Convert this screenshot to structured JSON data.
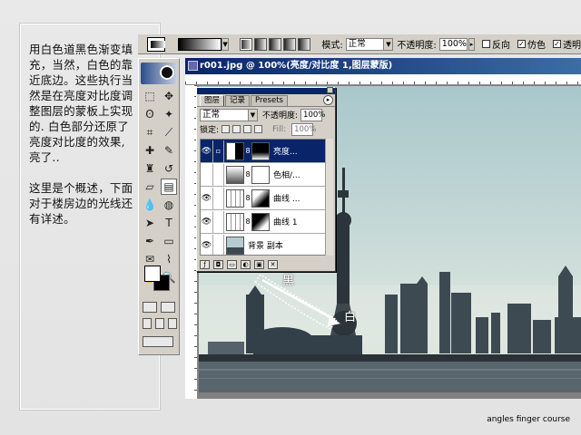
{
  "tutorial": {
    "paragraph1": "用白色道黑色渐变填充，当然，白色的靠近底边。这些执行当然是在亮度对比度调整图层的蒙板上实现的. 白色部分还原了亮度对比度的效果, 亮了..",
    "paragraph2": "这里是个概述，下面对于楼房边的光线还有详述。"
  },
  "options_bar": {
    "mode_label": "模式:",
    "mode_value": "正常",
    "opacity_label": "不透明度:",
    "opacity_value": "100%",
    "reverse_label": "反向",
    "dither_label": "仿色",
    "transparency_label": "透明",
    "reverse_checked": false,
    "dither_checked": true,
    "transparency_checked": true
  },
  "document": {
    "title": "r001.jpg @ 100%(亮度/对比度 1,图层蒙版)"
  },
  "canvas_annotations": {
    "black_label": "黑",
    "white_label": "白"
  },
  "layers_panel": {
    "tabs": [
      "图层",
      "记录",
      "Presets"
    ],
    "active_tab": 0,
    "blend_mode": "正常",
    "opacity_label": "不透明度:",
    "opacity_value": "100%",
    "lock_label": "锁定:",
    "fill_label": "Fill:",
    "fill_value": "100%",
    "layers": [
      {
        "name": "亮度...",
        "visible": true,
        "selected": true
      },
      {
        "name": "色相/...",
        "visible": false,
        "selected": false
      },
      {
        "name": "曲线 ...",
        "visible": true,
        "selected": false
      },
      {
        "name": "曲线 1",
        "visible": true,
        "selected": false
      },
      {
        "name": "背景 副本",
        "visible": true,
        "selected": false
      }
    ]
  },
  "footer": {
    "credit": "angles finger course"
  }
}
